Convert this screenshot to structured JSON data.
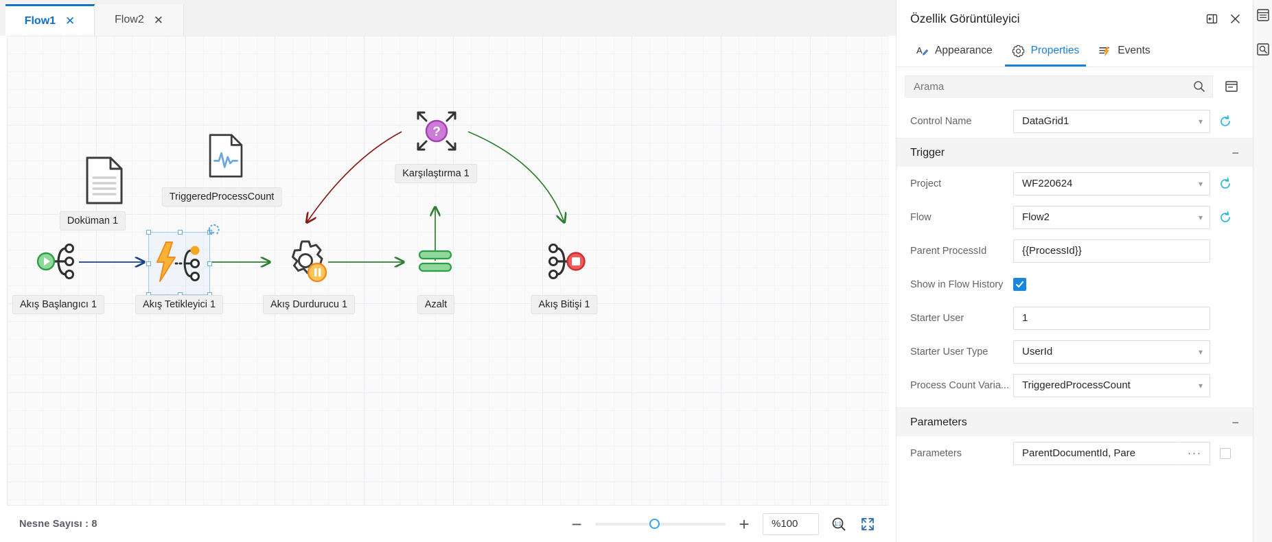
{
  "tabs": [
    {
      "label": "Flow1",
      "close": "✕",
      "active": true
    },
    {
      "label": "Flow2",
      "close": "✕",
      "active": false
    }
  ],
  "canvas": {
    "nodes": [
      {
        "id": "dokuman",
        "label": "Doküman 1",
        "icon": "document-icon"
      },
      {
        "id": "tpc",
        "label": "TriggeredProcessCount",
        "icon": "variable-document-icon"
      },
      {
        "id": "karsilastirma",
        "label": "Karşılaştırma 1",
        "icon": "comparison-question-icon"
      },
      {
        "id": "baslangic",
        "label": "Akış Başlangıcı 1",
        "icon": "flow-start-icon"
      },
      {
        "id": "tetikleyici",
        "label": "Akış Tetikleyici 1",
        "icon": "flow-trigger-icon"
      },
      {
        "id": "durdurucu",
        "label": "Akış Durdurucu 1",
        "icon": "flow-stopper-icon"
      },
      {
        "id": "azalt",
        "label": "Azalt",
        "icon": "decrement-icon"
      },
      {
        "id": "bitis",
        "label": "Akış Bitişi 1",
        "icon": "flow-end-icon"
      }
    ],
    "selected_node": "Akış Tetikleyici 1"
  },
  "statusbar": {
    "object_count_label": "Nesne Sayısı : 8",
    "zoom_out": "−",
    "zoom_in": "+",
    "zoom_value": "%100",
    "zoom_slider_percent": 45
  },
  "panel": {
    "title": "Özellik Görüntüleyici",
    "pin_icon": "pin-icon",
    "close_icon": "close-icon",
    "tabs": [
      {
        "label": "Appearance",
        "icon": "appearance-icon",
        "active": false
      },
      {
        "label": "Properties",
        "icon": "gear-icon",
        "active": true
      },
      {
        "label": "Events",
        "icon": "events-icon",
        "active": false
      }
    ],
    "search": {
      "placeholder": "Arama",
      "value": "",
      "icon": "search-icon"
    },
    "collapse_all_icon": "collapse-all-icon",
    "control_name": {
      "label": "Control Name",
      "value": "DataGrid1",
      "refresh_icon": "refresh-icon"
    },
    "sections": [
      {
        "title": "Trigger",
        "collapse": "−",
        "fields": [
          {
            "label": "Project",
            "value": "WF220624",
            "type": "select",
            "refresh": true
          },
          {
            "label": "Flow",
            "value": "Flow2",
            "type": "select",
            "refresh": true
          },
          {
            "label": "Parent ProcessId",
            "value": "{{ProcessId}}",
            "type": "text",
            "refresh": false
          },
          {
            "label": "Show in Flow History",
            "value": "",
            "type": "checkbox",
            "checked": true
          },
          {
            "label": "Starter User",
            "value": "1",
            "type": "text",
            "refresh": false
          },
          {
            "label": "Starter User Type",
            "value": "UserId",
            "type": "select",
            "refresh": false
          },
          {
            "label": "Process Count Varia...",
            "value": "TriggeredProcessCount",
            "type": "select",
            "refresh": false
          }
        ]
      },
      {
        "title": "Parameters",
        "collapse": "−",
        "fields": [
          {
            "label": "Parameters",
            "value": "ParentDocumentId, Pare",
            "type": "dots",
            "dots": "···",
            "checked": false
          }
        ]
      }
    ]
  },
  "rail": [
    {
      "icon": "list-panel-icon"
    },
    {
      "icon": "search-panel-icon"
    }
  ],
  "colors": {
    "accent": "#1a7fd4",
    "tab_active": "#0b6fc4",
    "green": "#2e7d32",
    "orange": "#f5a623",
    "red": "#e04b4b",
    "purple": "#b455c0",
    "dark_red_edge": "#8b1a1a",
    "blue_edge": "#1a3f8b"
  }
}
